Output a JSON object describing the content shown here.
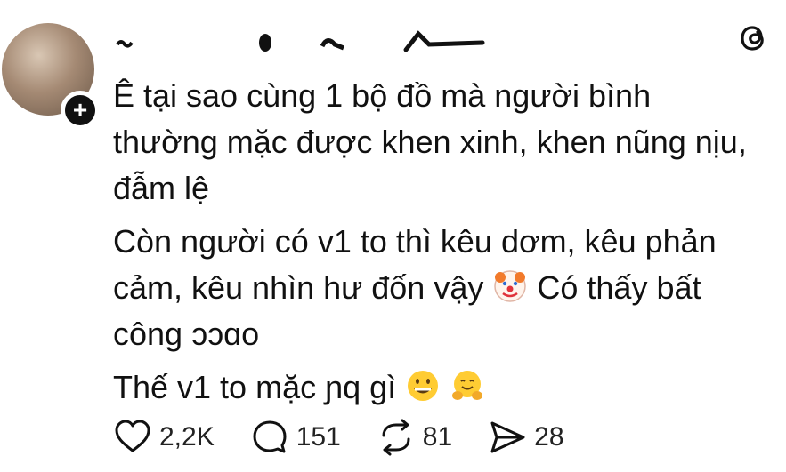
{
  "post": {
    "text_line1": "Ê tại sao cùng 1 bộ đồ mà người bình",
    "text_line2": "thường mặc được khen xinh, khen nũng nịu,",
    "text_line3": "đẫm lệ",
    "text_line4": "Còn người có v1 to thì kêu dơm, kêu phản",
    "text_line5_prefix": "cảm, kêu nhìn hư đốn vậy",
    "text_line5_suffix": "Có thấy bất",
    "text_line6": "công ɔɔɑo",
    "text_line7_prefix": "Thế v1 to mặc",
    "text_line7_mid": "ɲq gì"
  },
  "actions": {
    "likes": "2,2K",
    "comments": "151",
    "reposts": "81",
    "shares": "28"
  },
  "icons": {
    "like": "heart-icon",
    "comment": "comment-bubble-icon",
    "repost": "repost-icon",
    "share": "send-icon",
    "brand": "threads-logo-icon"
  },
  "colors": {
    "text": "#111111",
    "background": "#ffffff"
  }
}
